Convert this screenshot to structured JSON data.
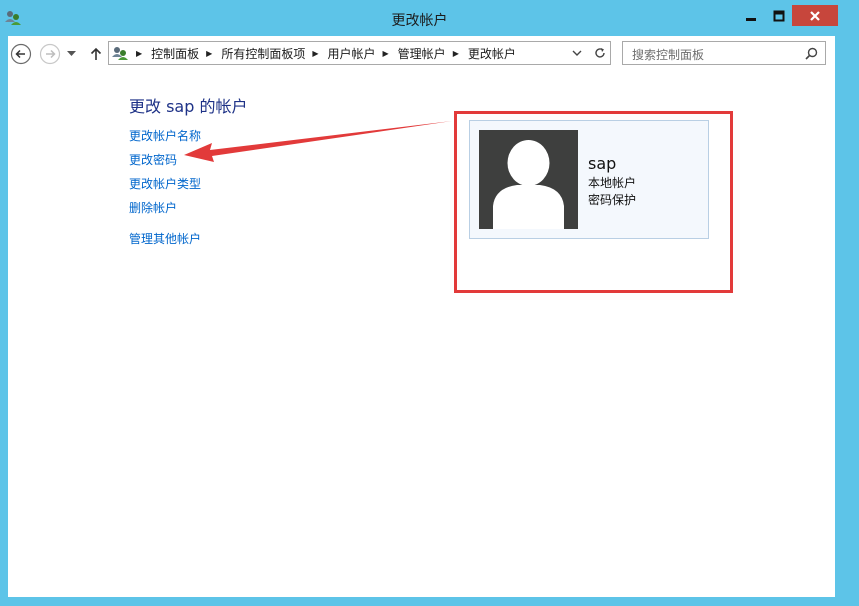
{
  "window": {
    "title": "更改帐户",
    "titlebar_color": "#5dc4e8",
    "close_color": "#c7463c"
  },
  "nav": {
    "back_icon": "back-arrow-icon",
    "forward_icon": "forward-arrow-icon",
    "up_icon": "up-arrow-icon",
    "breadcrumbs": [
      "控制面板",
      "所有控制面板项",
      "用户帐户",
      "管理帐户",
      "更改帐户"
    ],
    "search_placeholder": "搜索控制面板"
  },
  "main": {
    "heading": "更改 sap 的帐户",
    "links": [
      "更改帐户名称",
      "更改密码",
      "更改帐户类型",
      "删除帐户"
    ],
    "other_link": "管理其他帐户",
    "link_color": "#0066cc",
    "heading_color": "#1e3287"
  },
  "account": {
    "name": "sap",
    "type": "本地帐户",
    "protection": "密码保护"
  },
  "annotation": {
    "color": "#e23a3a"
  }
}
